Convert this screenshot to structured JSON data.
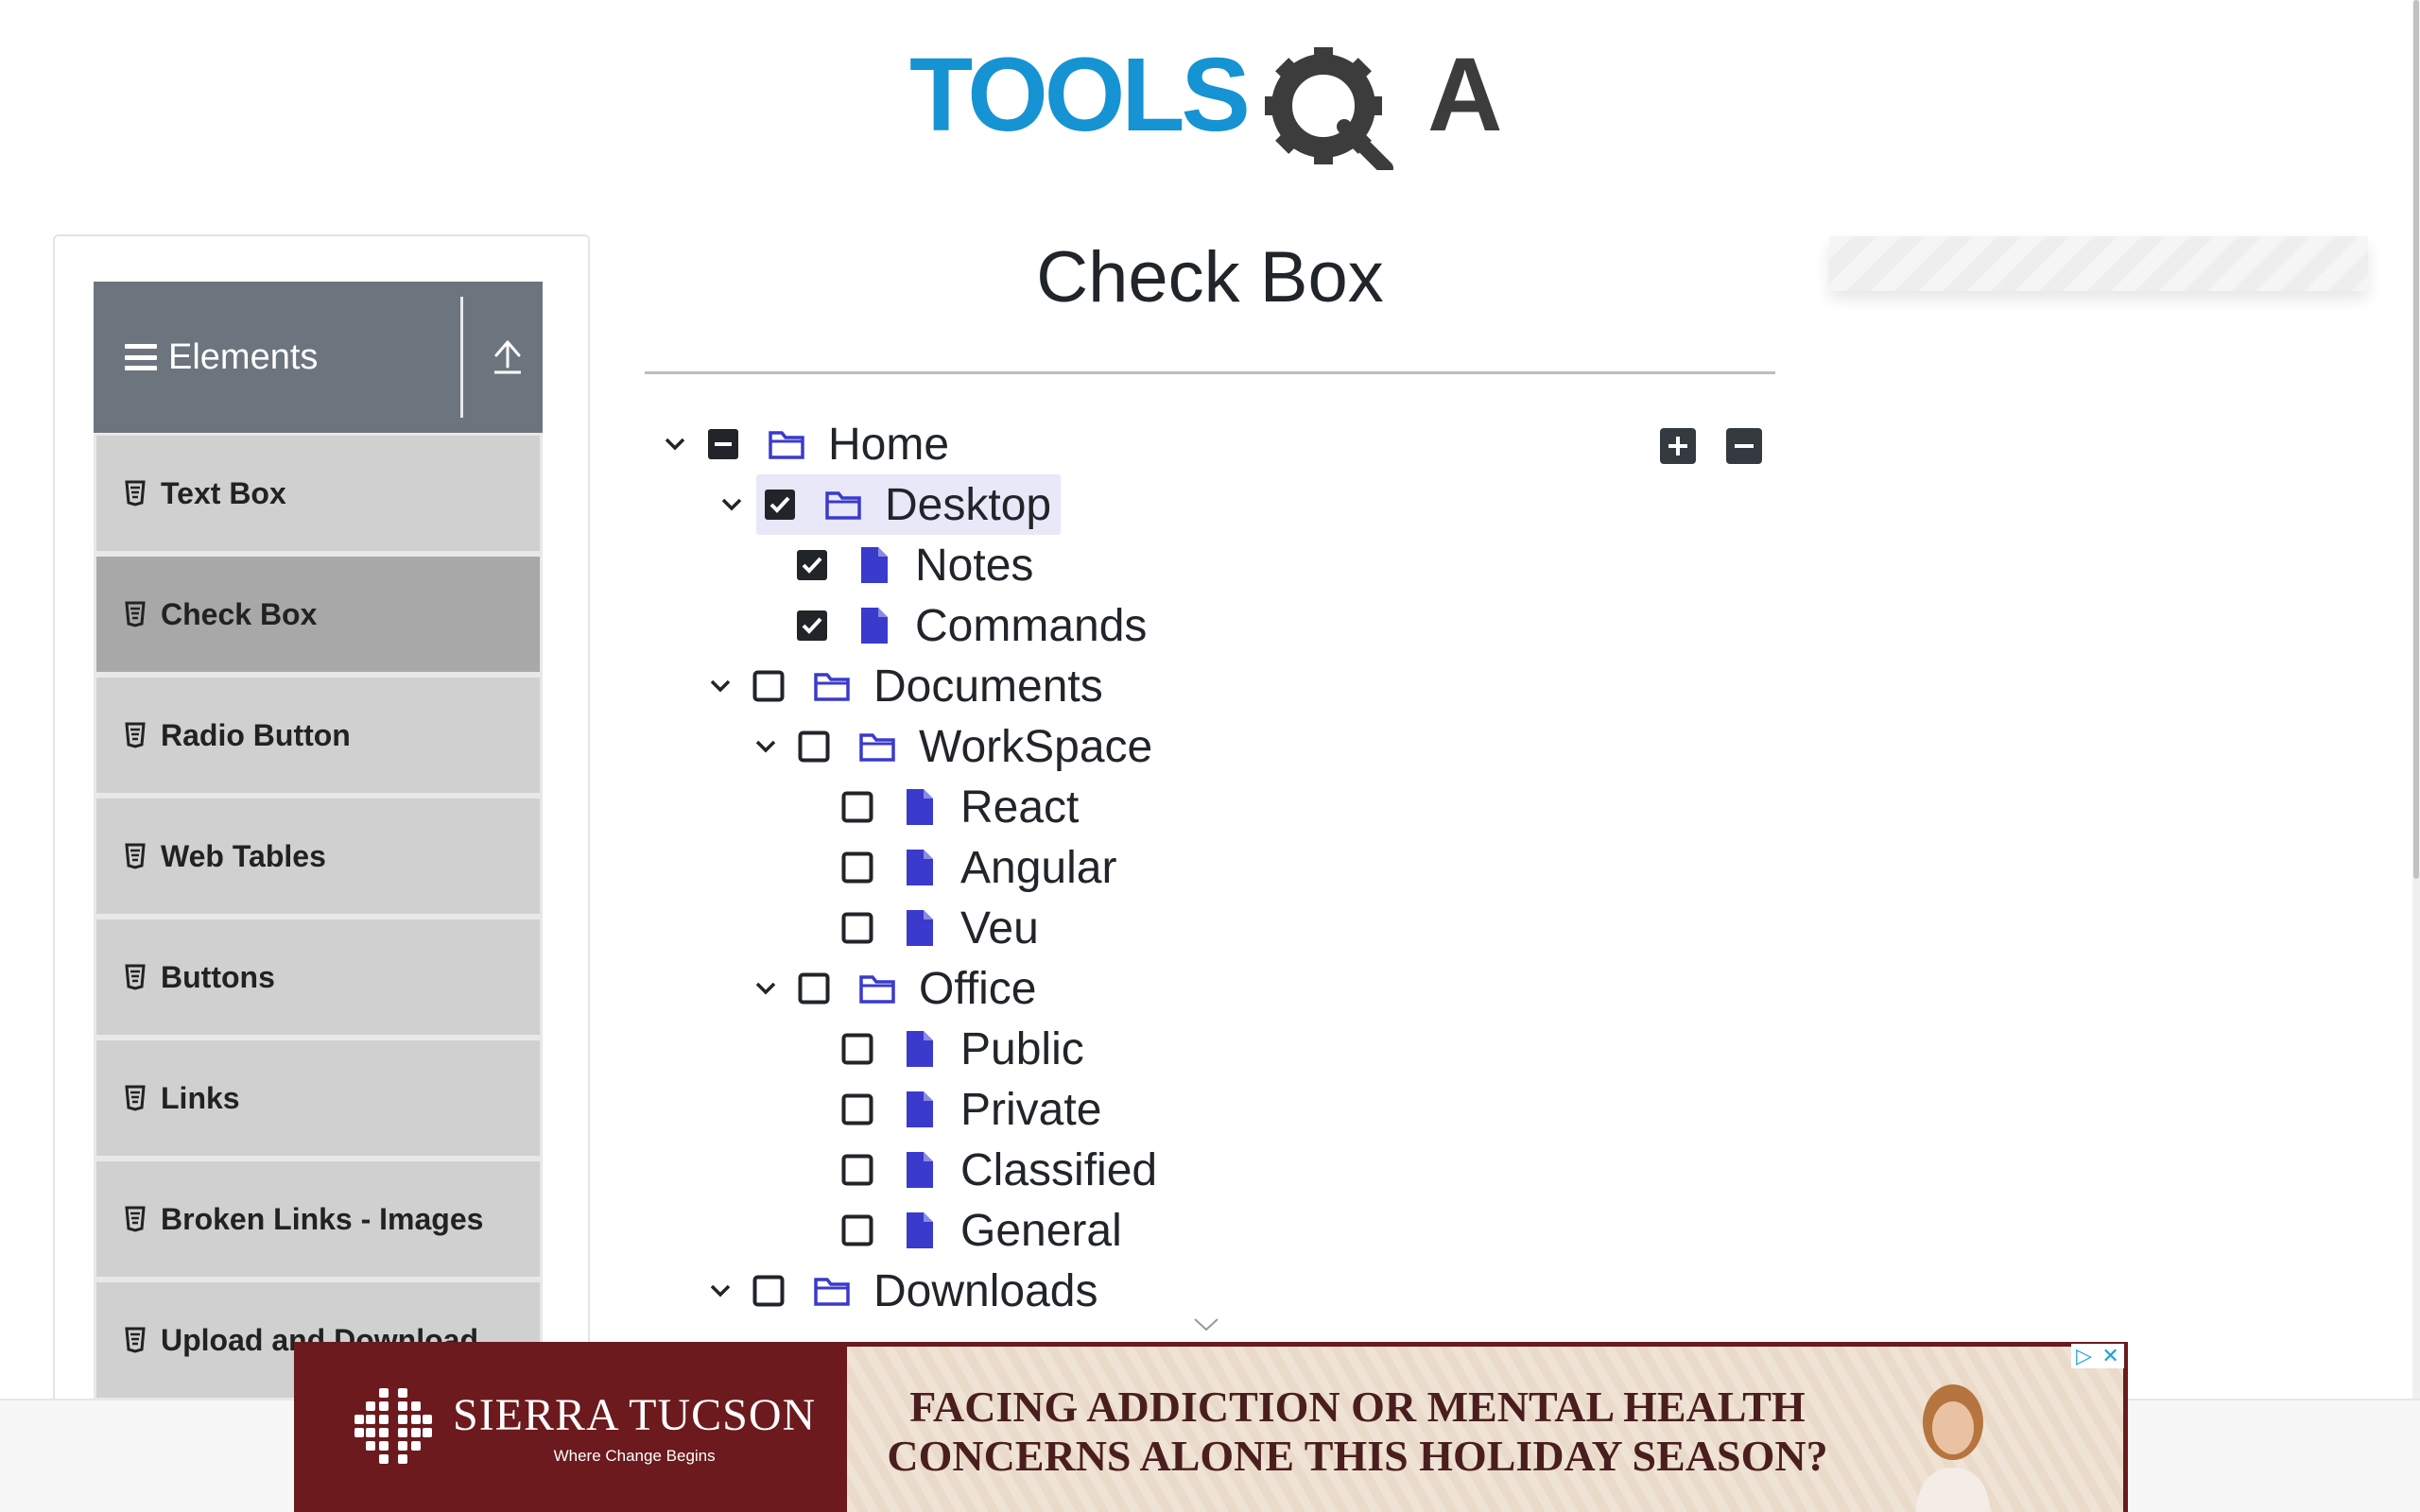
{
  "brand": {
    "logo_text": "TOOLSQA"
  },
  "sidebar": {
    "group_title": "Elements",
    "items": [
      {
        "label": "Text Box",
        "active": false
      },
      {
        "label": "Check Box",
        "active": true
      },
      {
        "label": "Radio Button",
        "active": false
      },
      {
        "label": "Web Tables",
        "active": false
      },
      {
        "label": "Buttons",
        "active": false
      },
      {
        "label": "Links",
        "active": false
      },
      {
        "label": "Broken Links - Images",
        "active": false
      },
      {
        "label": "Upload and Download",
        "active": false
      }
    ]
  },
  "main": {
    "title": "Check Box",
    "tree": {
      "expand_all_icon": "plus-square-icon",
      "collapse_all_icon": "minus-square-icon",
      "nodes": [
        {
          "label": "Home",
          "type": "folder",
          "state": "partial",
          "expanded": true
        },
        {
          "label": "Desktop",
          "type": "folder",
          "state": "checked",
          "expanded": true
        },
        {
          "label": "Notes",
          "type": "file",
          "state": "checked"
        },
        {
          "label": "Commands",
          "type": "file",
          "state": "checked"
        },
        {
          "label": "Documents",
          "type": "folder",
          "state": "unchecked",
          "expanded": true
        },
        {
          "label": "WorkSpace",
          "type": "folder",
          "state": "unchecked",
          "expanded": true
        },
        {
          "label": "React",
          "type": "file",
          "state": "unchecked"
        },
        {
          "label": "Angular",
          "type": "file",
          "state": "unchecked"
        },
        {
          "label": "Veu",
          "type": "file",
          "state": "unchecked"
        },
        {
          "label": "Office",
          "type": "folder",
          "state": "unchecked",
          "expanded": true
        },
        {
          "label": "Public",
          "type": "file",
          "state": "unchecked"
        },
        {
          "label": "Private",
          "type": "file",
          "state": "unchecked"
        },
        {
          "label": "Classified",
          "type": "file",
          "state": "unchecked"
        },
        {
          "label": "General",
          "type": "file",
          "state": "unchecked"
        },
        {
          "label": "Downloads",
          "type": "folder",
          "state": "unchecked",
          "expanded": true
        }
      ]
    }
  },
  "ad": {
    "brand_name": "SIERRA TUCSON",
    "brand_tagline": "Where Change Begins",
    "headline_line1": "FACING ADDICTION OR MENTAL HEALTH",
    "headline_line2": "CONCERNS ALONE THIS HOLIDAY SEASON?"
  },
  "colors": {
    "sidebar_header": "#6c757d",
    "sidebar_item": "#d0d0d0",
    "sidebar_item_active": "#a8a8a8",
    "tree_icon": "#3a3acd",
    "ad_background": "#6c1a1d"
  }
}
